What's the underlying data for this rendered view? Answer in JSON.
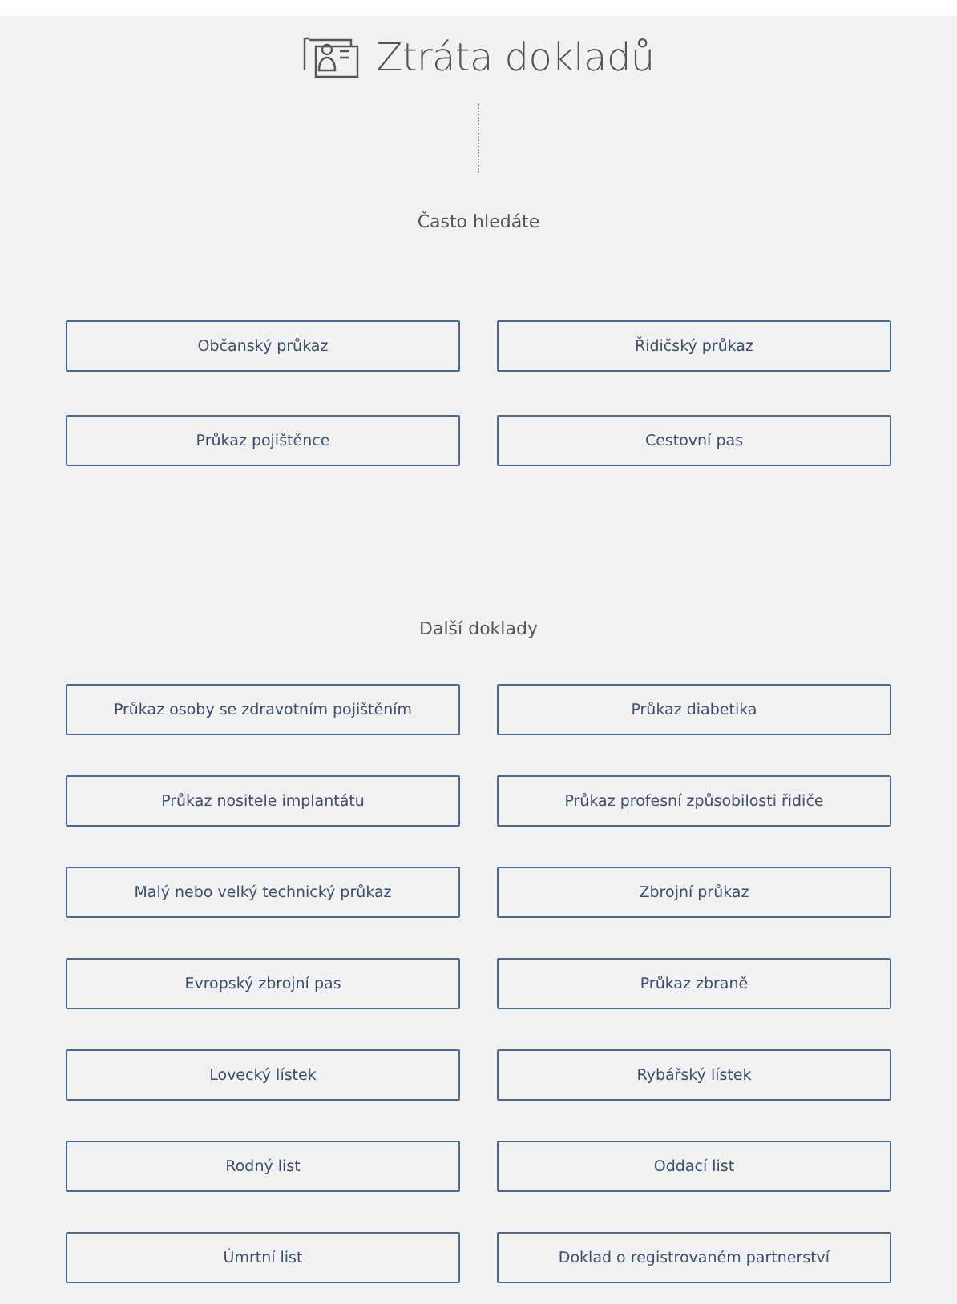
{
  "title": "Ztráta dokladů",
  "sections": [
    {
      "heading": "Často hledáte",
      "items": [
        "Občanský průkaz",
        "Řidičský průkaz",
        "Průkaz pojištěnce",
        "Cestovní pas"
      ]
    },
    {
      "heading": "Další doklady",
      "items": [
        "Průkaz osoby se zdravotním pojištěním",
        "Průkaz diabetika",
        "Průkaz nositele implantátu",
        "Průkaz profesní způsobilosti řidiče",
        "Malý nebo velký technický průkaz",
        "Zbrojní průkaz",
        "Evropský zbrojní pas",
        "Průkaz zbraně",
        "Lovecký lístek",
        "Rybářský lístek",
        "Rodný list",
        "Oddací list",
        "Úmrtní list",
        "Doklad o registrovaném partnerství"
      ]
    }
  ]
}
